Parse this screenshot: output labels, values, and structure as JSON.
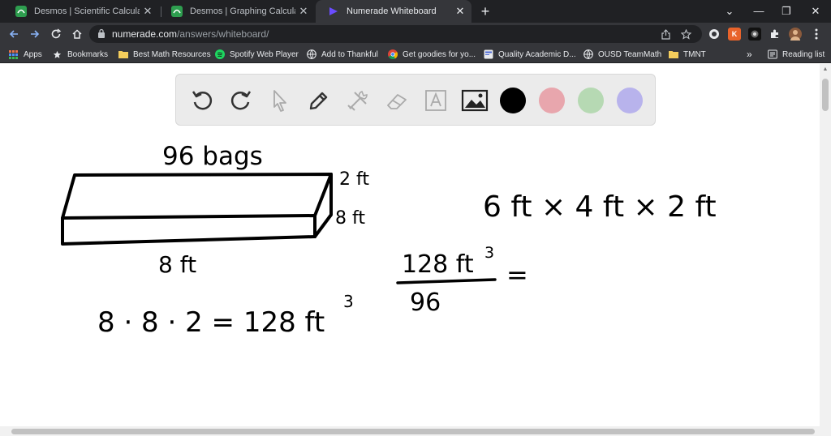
{
  "browser": {
    "tabs": [
      {
        "title": "Desmos | Scientific Calculator",
        "icon": "desmos-icon",
        "active": false
      },
      {
        "title": "Desmos | Graphing Calculator",
        "icon": "desmos-icon",
        "active": false
      },
      {
        "title": "Numerade Whiteboard",
        "icon": "numerade-icon",
        "active": true
      }
    ],
    "new_tab_label": "+",
    "url_host": "numerade.com",
    "url_path": "/answers/whiteboard/",
    "bookmarks": [
      {
        "label": "Apps",
        "icon": "apps-grid-icon"
      },
      {
        "label": "Bookmarks",
        "icon": "star-icon"
      },
      {
        "label": "Best Math Resources",
        "icon": "folder-icon"
      },
      {
        "label": "Spotify Web Player",
        "icon": "spotify-icon"
      },
      {
        "label": "Add to Thankful",
        "icon": "globe-icon"
      },
      {
        "label": "Get goodies for yo...",
        "icon": "chrome-icon"
      },
      {
        "label": "Quality Academic D...",
        "icon": "doc-icon"
      },
      {
        "label": "OUSD TeamMath",
        "icon": "globe-icon"
      },
      {
        "label": "TMNT",
        "icon": "folder-icon"
      }
    ],
    "more_bookmarks_label": "»",
    "reading_list_label": "Reading list",
    "colors": {
      "tabstrip": "#202124",
      "toolbar": "#35363a",
      "accent_desmos": "#2e9e4f",
      "accent_numerade": "#6a4cff"
    }
  },
  "whiteboard": {
    "tools": [
      "undo-icon",
      "redo-icon",
      "pointer-icon",
      "pen-icon",
      "tools-icon",
      "eraser-icon",
      "text-icon",
      "image-icon"
    ],
    "colors": [
      "#000000",
      "#e8a6ad",
      "#b6d9b3",
      "#b8b3ec"
    ]
  },
  "handwriting": {
    "bags": "96 bags",
    "height": "2 ft",
    "depth": "8 ft",
    "length": "8 ft",
    "dims": "6 ft × 4 ft × 2 ft",
    "volume_eq": "8 · 8 · 2 = 128 ft",
    "exp": "3",
    "numerator": "128 ft",
    "denominator": "96",
    "equals": "="
  }
}
